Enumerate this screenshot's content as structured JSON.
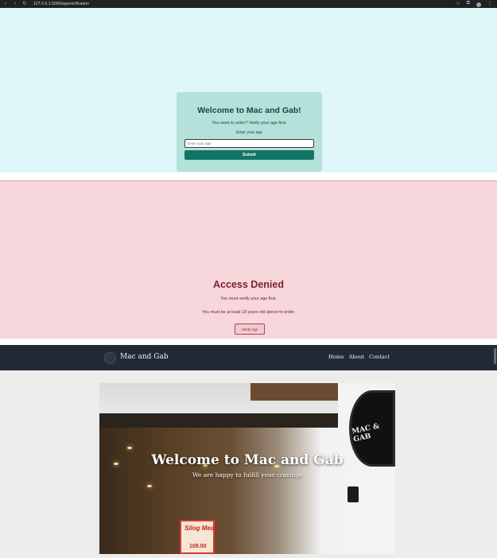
{
  "browser": {
    "url": "127.0.0.1:5000/ageverification",
    "back_icon": "arrow-left-icon",
    "forward_icon": "arrow-right-icon",
    "reload_icon": "reload-icon"
  },
  "age_verification": {
    "title": "Welcome to Mac and Gab!",
    "subtitle": "You want to order? Verify your age first.",
    "label": "Enter your age",
    "input_placeholder": "Enter your age",
    "submit_label": "Submit"
  },
  "access_denied": {
    "title": "Access Denied",
    "message1": "You must verify your age first.",
    "message2": "You must be at least 18 years old above to order.",
    "button_label": "Verify Age"
  },
  "home": {
    "brand": "Mac and Gab",
    "nav": [
      "Home",
      "About",
      "Contact"
    ],
    "hero_title": "Welcome to Mac and Gab",
    "hero_subtitle": "We are happy to fulfill your cravings",
    "sign_text": "MAC & GAB",
    "poster_text": "Silog Meals",
    "poster_price": "109.00"
  },
  "colors": {
    "card_bg": "#b4e1d9",
    "submit_bg": "#137466",
    "denied_bg": "#f7d7db",
    "navbar_bg": "#222a35"
  }
}
